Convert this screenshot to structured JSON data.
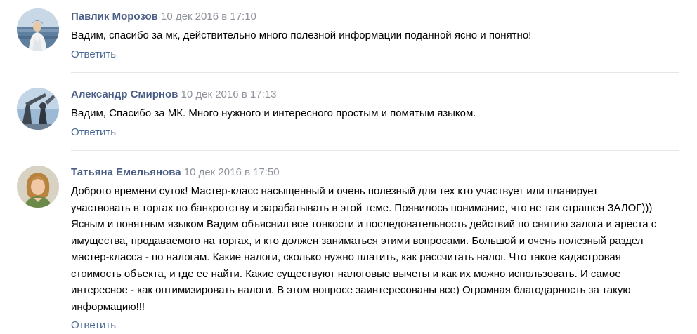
{
  "comments": [
    {
      "author": "Павлик Морозов",
      "date": "10 дек 2016 в 17:10",
      "text": "Вадим, спасибо за мк, действительно много полезной информации поданной ясно и понятно!",
      "reply_label": "Ответить",
      "avatar": "avatar-photo-person-water"
    },
    {
      "author": "Александр Смирнов",
      "date": "10 дек 2016 в 17:13",
      "text": "Вадим, Спасибо за МК. Много нужного и интересного простым и помятым языком.",
      "reply_label": "Ответить",
      "avatar": "avatar-photo-monument-sky"
    },
    {
      "author": "Татьяна Емельянова",
      "date": "10 дек 2016 в 17:50",
      "text": "Доброго времени суток! Мастер-класс насыщенный и очень полезный для тех кто участвует или планирует участвовать в торгах по банкротству и зарабатывать в этой теме. Появилось понимание, что не так страшен ЗАЛОГ))) Ясным и понятным языком Вадим объяснил все тонкости и последовательность действий по снятию залога и ареста с имущества, продаваемого на торгах, и кто должен заниматься этими вопросами. Большой и очень полезный раздел мастер-класса - по налогам. Какие налоги, сколько нужно платить, как рассчитать налог. Что такое кадастровая стоимость объекта, и где ее найти. Какие существуют налоговые вычеты и как их можно использовать. И самое интересное - как оптимизировать налоги. В этом вопросе заинтересованы все) Огромная благодарность за такую информацию!!!",
      "reply_label": "Ответить",
      "avatar": "avatar-photo-woman"
    }
  ],
  "colors": {
    "author": "#4a5d85",
    "date": "#8f939b",
    "reply": "#4a6b96",
    "divider": "#e4e6ea",
    "text": "#000000"
  }
}
